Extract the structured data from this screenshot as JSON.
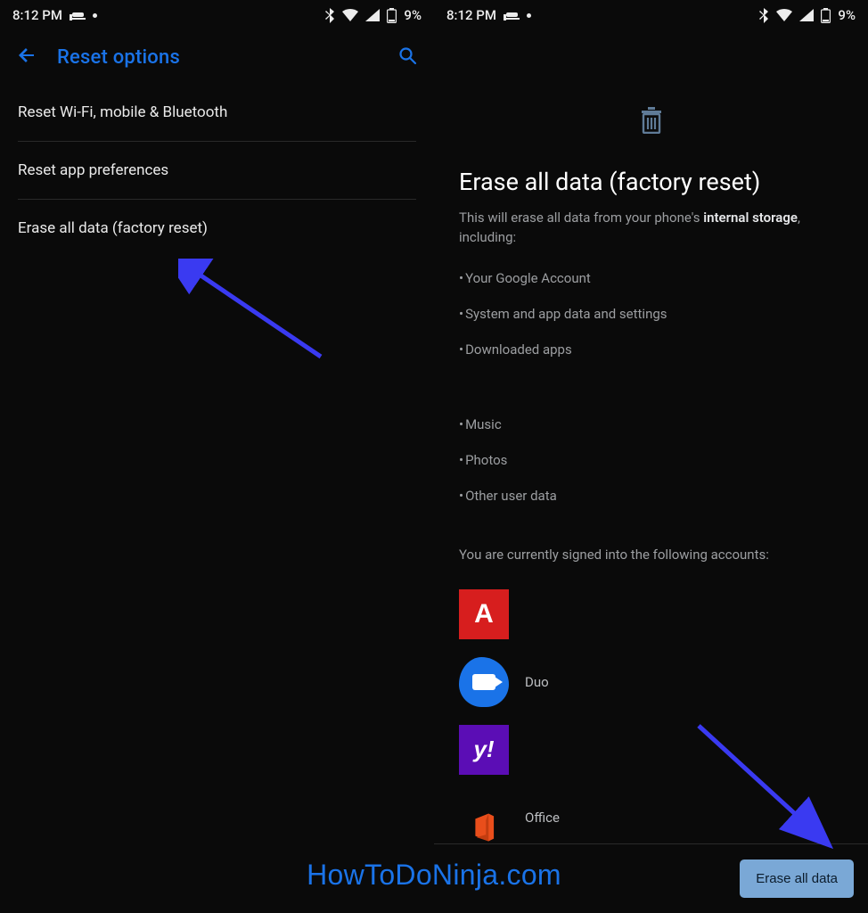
{
  "status": {
    "time": "8:12 PM",
    "battery_text": "9%"
  },
  "left": {
    "title": "Reset options",
    "items": [
      "Reset Wi-Fi, mobile & Bluetooth",
      "Reset app preferences",
      "Erase all data (factory reset)"
    ]
  },
  "right": {
    "heading": "Erase all data (factory reset)",
    "desc_prefix": "This will erase all data from your phone's ",
    "desc_bold": "internal storage",
    "desc_suffix": ", including:",
    "bullets_a": [
      "Your Google Account",
      "System and app data and settings",
      "Downloaded apps"
    ],
    "bullets_b": [
      "Music",
      "Photos",
      "Other user data"
    ],
    "accounts_label": "You are currently signed into the following accounts:",
    "accounts": [
      "",
      "Duo",
      "",
      "Office"
    ],
    "action_label": "Erase all data"
  },
  "watermark": "HowToDoNinja.com"
}
